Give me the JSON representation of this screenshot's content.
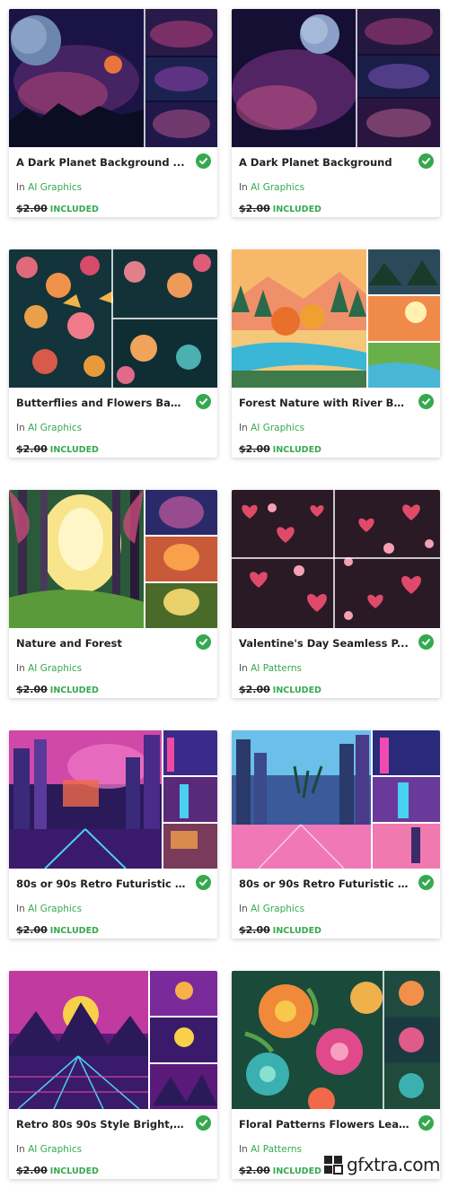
{
  "cards": [
    {
      "title": "A Dark Planet Background ...",
      "in_label": "In",
      "category": "AI Graphics",
      "old_price": "$2.00",
      "included": "INCLUDED",
      "thumb": "dark-planet"
    },
    {
      "title": "A Dark Planet Background",
      "in_label": "In",
      "category": "AI Graphics",
      "old_price": "$2.00",
      "included": "INCLUDED",
      "thumb": "dark-planet-2"
    },
    {
      "title": "Butterflies and Flowers Bac...",
      "in_label": "In",
      "category": "AI Graphics",
      "old_price": "$2.00",
      "included": "INCLUDED",
      "thumb": "butterflies"
    },
    {
      "title": "Forest Nature with River Ba...",
      "in_label": "In",
      "category": "AI Graphics",
      "old_price": "$2.00",
      "included": "INCLUDED",
      "thumb": "forest-river"
    },
    {
      "title": "Nature and Forest",
      "in_label": "In",
      "category": "AI Graphics",
      "old_price": "$2.00",
      "included": "INCLUDED",
      "thumb": "nature-forest"
    },
    {
      "title": "Valentine's Day Seamless P...",
      "in_label": "In",
      "category": "AI Patterns",
      "old_price": "$2.00",
      "included": "INCLUDED",
      "thumb": "valentine"
    },
    {
      "title": "80s or 90s Retro Futuristic El...",
      "in_label": "In",
      "category": "AI Graphics",
      "old_price": "$2.00",
      "included": "INCLUDED",
      "thumb": "retro-city"
    },
    {
      "title": "80s or 90s Retro Futuristic El...",
      "in_label": "In",
      "category": "AI Graphics",
      "old_price": "$2.00",
      "included": "INCLUDED",
      "thumb": "retro-city-2"
    },
    {
      "title": "Retro 80s 90s Style Bright, N...",
      "in_label": "In",
      "category": "AI Graphics",
      "old_price": "$2.00",
      "included": "INCLUDED",
      "thumb": "retro-mountains"
    },
    {
      "title": "Floral Patterns Flowers Leav...",
      "in_label": "In",
      "category": "AI Patterns",
      "old_price": "$2.00",
      "included": "INCLUDED",
      "thumb": "floral"
    }
  ],
  "watermark": {
    "text": "gfxtra.com"
  },
  "colors": {
    "accent_green": "#35a94f",
    "text_dark": "#222222"
  }
}
